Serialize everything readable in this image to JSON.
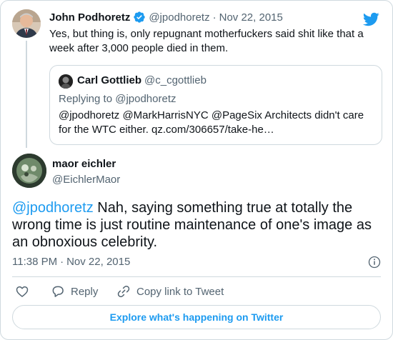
{
  "parent_tweet": {
    "name": "John Podhoretz",
    "handle": "@jpodhoretz",
    "separator": "·",
    "date": "Nov 22, 2015",
    "text": "Yes, but thing is, only repugnant motherfuckers said shit like that a week after 3,000 people died in them."
  },
  "quoted_tweet": {
    "name": "Carl Gottlieb",
    "handle": "@c_cgottlieb",
    "replying_to": "Replying to @jpodhoretz",
    "text": "@jpodhoretz @MarkHarrisNYC @PageSix Architects didn't care for the WTC either. qz.com/306657/take-he…"
  },
  "main_tweet": {
    "name": "maor eichler",
    "handle": "@EichlerMaor",
    "mention": "@jpodhoretz",
    "text": " Nah, saying something true at totally the wrong time is just routine maintenance of one's image as an obnoxious celebrity.",
    "time": "11:38 PM",
    "separator": "·",
    "date": "Nov 22, 2015"
  },
  "actions": {
    "like_icon": "heart-icon",
    "reply_label": "Reply",
    "copy_link_label": "Copy link to Tweet"
  },
  "explore_button": "Explore what's happening on Twitter",
  "colors": {
    "accent": "#1d9bf0",
    "text": "#0f1419",
    "muted": "#536471",
    "border": "#cfd9de"
  }
}
